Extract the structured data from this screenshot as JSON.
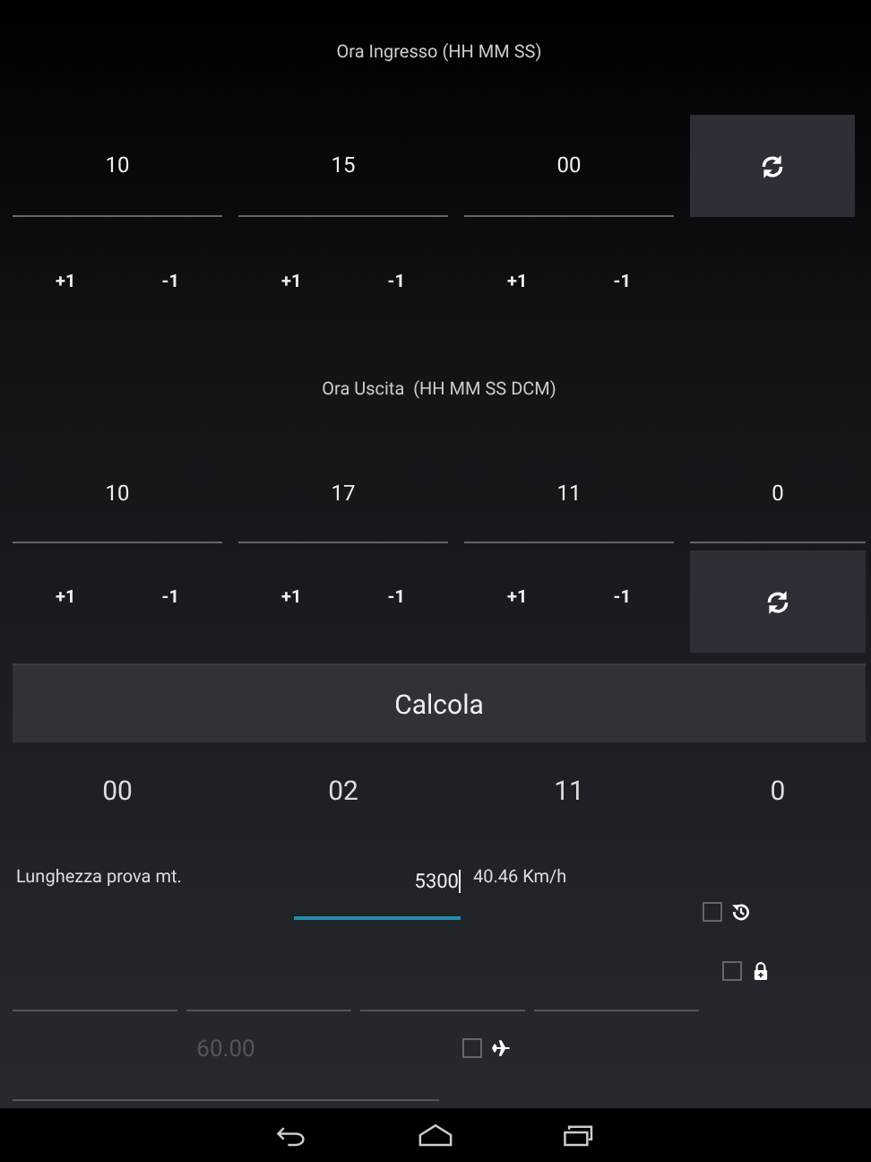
{
  "entry": {
    "title": "Ora Ingresso (HH MM SS)",
    "fields": [
      {
        "value": "10"
      },
      {
        "value": "15"
      },
      {
        "value": "00"
      }
    ],
    "steps": [
      {
        "plus": "+1",
        "minus": "-1"
      },
      {
        "plus": "+1",
        "minus": "-1"
      },
      {
        "plus": "+1",
        "minus": "-1"
      }
    ]
  },
  "exit": {
    "title": "Ora Uscita  (HH MM SS DCM)",
    "fields": [
      {
        "value": "10"
      },
      {
        "value": "17"
      },
      {
        "value": "11"
      },
      {
        "value": "0"
      }
    ],
    "steps": [
      {
        "plus": "+1",
        "minus": "-1"
      },
      {
        "plus": "+1",
        "minus": "-1"
      },
      {
        "plus": "+1",
        "minus": "-1"
      }
    ]
  },
  "calculate_button": "Calcola",
  "results": [
    "00",
    "02",
    "11",
    "0"
  ],
  "length": {
    "label": "Lunghezza prova mt.",
    "value": "5300",
    "focused": true,
    "speed": "40.46 Km/h"
  },
  "blank_fields": [
    {
      "focused": false
    },
    {
      "focused": false
    },
    {
      "focused": false
    },
    {
      "focused": false
    }
  ],
  "limit_field": {
    "placeholder": "60.00"
  },
  "options": [
    {
      "kind": "history",
      "checked": false
    },
    {
      "kind": "lock",
      "checked": false
    },
    {
      "kind": "airplane",
      "checked": false
    }
  ]
}
